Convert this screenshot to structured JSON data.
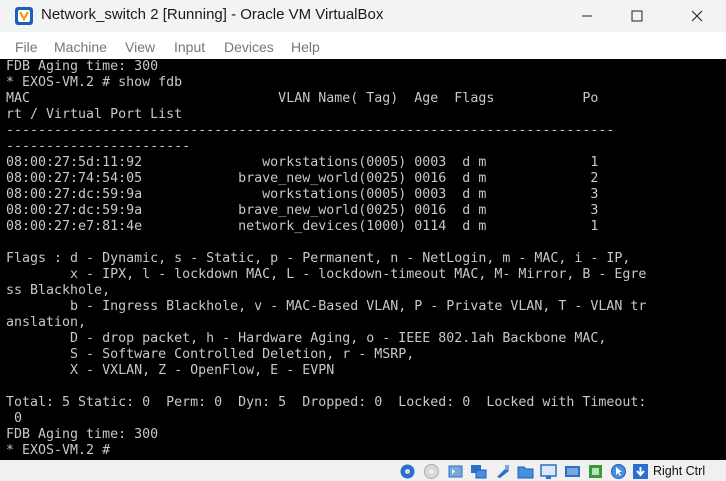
{
  "window": {
    "title": "Network_switch 2 [Running] - Oracle VM VirtualBox",
    "title_icon": "virtualbox-icon",
    "controls": [
      "minimize-icon",
      "maximize-icon",
      "close-icon"
    ]
  },
  "menu": {
    "items": [
      "File",
      "Machine",
      "View",
      "Input",
      "Devices",
      "Help"
    ]
  },
  "terminal": {
    "lines": [
      "FDB Aging time: 300",
      "* EXOS-VM.2 # show fdb",
      "MAC                               VLAN Name( Tag)  Age  Flags           Po",
      "rt / Virtual Port List",
      "----------------------------------------------------------------------------",
      "-----------------------",
      "08:00:27:5d:11:92               workstations(0005) 0003  d m             1",
      "08:00:27:74:54:05            brave_new_world(0025) 0016  d m             2",
      "08:00:27:dc:59:9a               workstations(0005) 0003  d m             3",
      "08:00:27:dc:59:9a            brave_new_world(0025) 0016  d m             3",
      "08:00:27:e7:81:4e            network_devices(1000) 0114  d m             1",
      "",
      "Flags : d - Dynamic, s - Static, p - Permanent, n - NetLogin, m - MAC, i - IP,",
      "        x - IPX, l - lockdown MAC, L - lockdown-timeout MAC, M- Mirror, B - Egre",
      "ss Blackhole,",
      "        b - Ingress Blackhole, v - MAC-Based VLAN, P - Private VLAN, T - VLAN tr",
      "anslation,",
      "        D - drop packet, h - Hardware Aging, o - IEEE 802.1ah Backbone MAC,",
      "        S - Software Controlled Deletion, r - MSRP,",
      "        X - VXLAN, Z - OpenFlow, E - EVPN",
      "",
      "Total: 5 Static: 0  Perm: 0  Dyn: 5  Dropped: 0  Locked: 0  Locked with Timeout:",
      " 0",
      "FDB Aging time: 300",
      "* EXOS-VM.2 #"
    ]
  },
  "statusbar": {
    "icons": [
      "hard-disk-icon",
      "optical-drive-icon",
      "audio-icon",
      "network-icon",
      "usb-icon",
      "shared-folders-icon",
      "display-icon",
      "video-capture-icon",
      "cpu-icon",
      "mouse-integration-icon",
      "keyboard-icon"
    ],
    "host_key": "Right Ctrl",
    "colors": {
      "accent_blue": "#2a6fcc",
      "green": "#3a9a3a"
    }
  }
}
